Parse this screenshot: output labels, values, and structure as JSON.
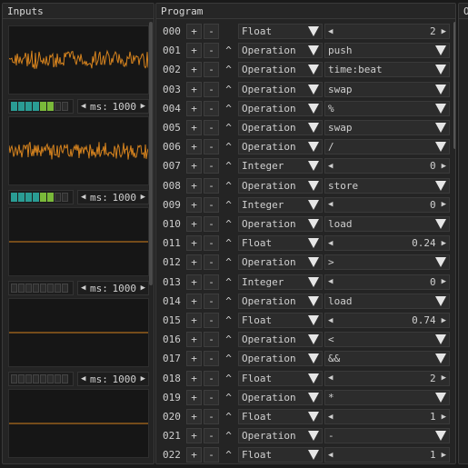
{
  "panels": {
    "inputs_title": "Inputs",
    "program_title": "Program",
    "outputs_title": "O"
  },
  "colors": {
    "signal": "#d4821e",
    "meter_on_teal": "#2a9c94",
    "meter_on_green": "#7ab93a",
    "meter_off": "#2c2c2c"
  },
  "inputs": [
    {
      "kind": "noise",
      "meter_level": 0.8,
      "ms_label": "ms:",
      "ms_value": "1000"
    },
    {
      "kind": "noise",
      "meter_level": 0.7,
      "ms_label": "ms:",
      "ms_value": "1000"
    },
    {
      "kind": "flat",
      "meter_level": 0.0,
      "ms_label": "ms:",
      "ms_value": "1000"
    },
    {
      "kind": "flat",
      "meter_level": 0.0,
      "ms_label": "ms:",
      "ms_value": "1000"
    },
    {
      "kind": "flat"
    }
  ],
  "program": [
    {
      "index": "000",
      "type": "Float",
      "value": "2",
      "has_up": false,
      "value_kind": "number"
    },
    {
      "index": "001",
      "type": "Operation",
      "value": "push",
      "has_up": true,
      "value_kind": "select"
    },
    {
      "index": "002",
      "type": "Operation",
      "value": "time:beat",
      "has_up": true,
      "value_kind": "select"
    },
    {
      "index": "003",
      "type": "Operation",
      "value": "swap",
      "has_up": true,
      "value_kind": "select"
    },
    {
      "index": "004",
      "type": "Operation",
      "value": "%",
      "has_up": true,
      "value_kind": "select"
    },
    {
      "index": "005",
      "type": "Operation",
      "value": "swap",
      "has_up": true,
      "value_kind": "select"
    },
    {
      "index": "006",
      "type": "Operation",
      "value": "/",
      "has_up": true,
      "value_kind": "select"
    },
    {
      "index": "007",
      "type": "Integer",
      "value": "0",
      "has_up": true,
      "value_kind": "number"
    },
    {
      "index": "008",
      "type": "Operation",
      "value": "store",
      "has_up": true,
      "value_kind": "select"
    },
    {
      "index": "009",
      "type": "Integer",
      "value": "0",
      "has_up": true,
      "value_kind": "number"
    },
    {
      "index": "010",
      "type": "Operation",
      "value": "load",
      "has_up": true,
      "value_kind": "select"
    },
    {
      "index": "011",
      "type": "Float",
      "value": "0.24",
      "has_up": true,
      "value_kind": "number"
    },
    {
      "index": "012",
      "type": "Operation",
      "value": ">",
      "has_up": true,
      "value_kind": "select"
    },
    {
      "index": "013",
      "type": "Integer",
      "value": "0",
      "has_up": true,
      "value_kind": "number"
    },
    {
      "index": "014",
      "type": "Operation",
      "value": "load",
      "has_up": true,
      "value_kind": "select"
    },
    {
      "index": "015",
      "type": "Float",
      "value": "0.74",
      "has_up": true,
      "value_kind": "number"
    },
    {
      "index": "016",
      "type": "Operation",
      "value": "<",
      "has_up": true,
      "value_kind": "select"
    },
    {
      "index": "017",
      "type": "Operation",
      "value": "&&",
      "has_up": true,
      "value_kind": "select"
    },
    {
      "index": "018",
      "type": "Float",
      "value": "2",
      "has_up": true,
      "value_kind": "number"
    },
    {
      "index": "019",
      "type": "Operation",
      "value": "*",
      "has_up": true,
      "value_kind": "select"
    },
    {
      "index": "020",
      "type": "Float",
      "value": "1",
      "has_up": true,
      "value_kind": "number"
    },
    {
      "index": "021",
      "type": "Operation",
      "value": "-",
      "has_up": true,
      "value_kind": "select"
    },
    {
      "index": "022",
      "type": "Float",
      "value": "1",
      "has_up": true,
      "value_kind": "number"
    }
  ],
  "buttons": {
    "add": "+",
    "remove": "-",
    "move_up": "^",
    "dec": "◀",
    "inc": "▶"
  }
}
